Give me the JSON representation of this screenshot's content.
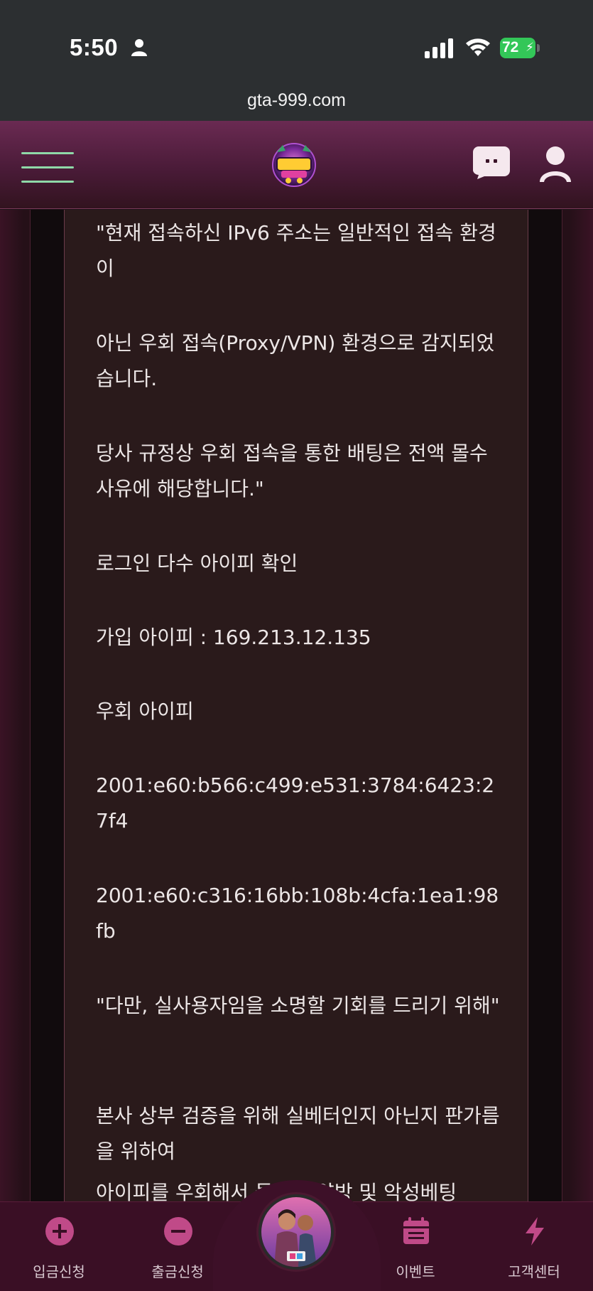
{
  "status_bar": {
    "time": "5:50",
    "battery": "72"
  },
  "browser": {
    "url": "gta-999.com"
  },
  "header": {
    "logo_icon": "gta-casino-logo",
    "menu_icon": "hamburger-menu-icon",
    "chat_icon": "chat-bubble-icon",
    "user_icon": "user-profile-icon",
    "accent": "#8fd9a8"
  },
  "content": {
    "paragraphs": [
      "\"현재 접속하신 IPv6 주소는 일반적인 접속 환경이",
      "아닌 우회 접속(Proxy/VPN) 환경으로 감지되었습니다.",
      "당사 규정상 우회 접속을 통한 배팅은 전액 몰수 사유에 해당합니다.\"",
      "로그인 다수 아이피 확인",
      "가입 아이피 : 169.213.12.135",
      "우회 아이피",
      "2001:e60:b566:c499:e531:3784:6423:27f4",
      "2001:e60:c316:16bb:108b:4cfa:1ea1:98fb",
      "\"다만, 실사용자임을 소명할 기회를 드리기 위해\"",
      "본사 상부 검증을 위해 실베터인지 아닌지 판가름을 위하여",
      "아이피를 우회해서 들어온 양방 및 악성베팅"
    ]
  },
  "bottom_nav": {
    "deposit": "입금신청",
    "withdraw": "출금신청",
    "events": "이벤트",
    "support": "고객센터",
    "center_icon": "game-character-icon"
  }
}
